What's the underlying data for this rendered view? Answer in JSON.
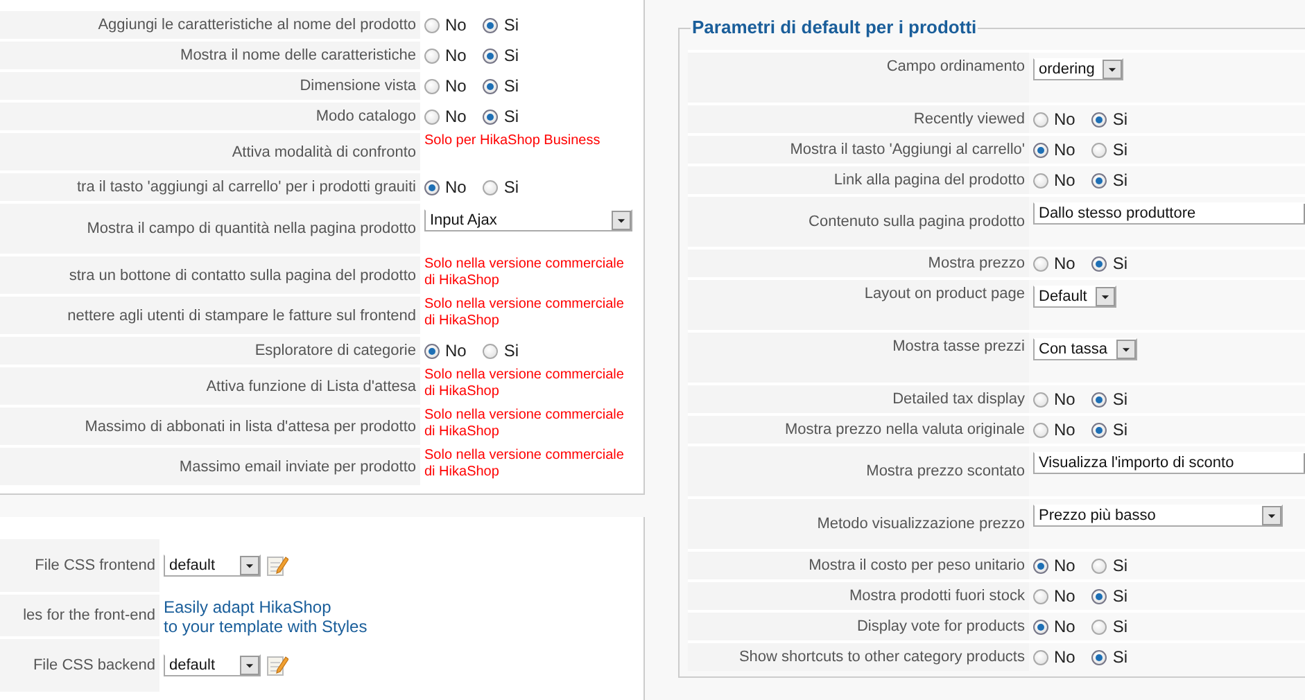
{
  "left_panel": {
    "rows": [
      {
        "label": "Aggiungi le caratteristiche al nome del prodotto",
        "kind": "radio",
        "options": [
          {
            "label": "No",
            "selected": false
          },
          {
            "label": "Si",
            "selected": true
          }
        ]
      },
      {
        "label": "Mostra il nome delle caratteristiche",
        "kind": "radio",
        "options": [
          {
            "label": "No",
            "selected": false
          },
          {
            "label": "Si",
            "selected": true
          }
        ]
      },
      {
        "label": "Dimensione vista",
        "kind": "radio",
        "options": [
          {
            "label": "No",
            "selected": false
          },
          {
            "label": "Si",
            "selected": true
          }
        ]
      },
      {
        "label": "Modo catalogo",
        "kind": "radio",
        "options": [
          {
            "label": "No",
            "selected": false
          },
          {
            "label": "Si",
            "selected": true
          }
        ]
      },
      {
        "label": "Attiva modalità di confronto",
        "kind": "note",
        "text": "Solo per HikaShop Business"
      },
      {
        "label": "tra il tasto 'aggiungi al carrello' per i prodotti grauiti",
        "kind": "radio",
        "options": [
          {
            "label": "No",
            "selected": true
          },
          {
            "label": "Si",
            "selected": false
          }
        ]
      },
      {
        "label": "Mostra il campo di quantità nella pagina prodotto",
        "kind": "select",
        "value": "Input Ajax"
      },
      {
        "label": "stra un bottone di contatto sulla pagina del prodotto",
        "kind": "note",
        "text": "Solo nella versione commerciale\ndi HikaShop"
      },
      {
        "label": "nettere agli utenti di stampare le fatture sul frontend",
        "kind": "note",
        "text": "Solo nella versione commerciale\ndi HikaShop"
      },
      {
        "label": "Esploratore di categorie",
        "kind": "radio",
        "options": [
          {
            "label": "No",
            "selected": true
          },
          {
            "label": "Si",
            "selected": false
          }
        ]
      },
      {
        "label": "Attiva funzione di Lista d'attesa",
        "kind": "note",
        "text": "Solo nella versione commerciale\ndi HikaShop"
      },
      {
        "label": "Massimo di abbonati in lista d'attesa per prodotto",
        "kind": "note",
        "text": "Solo nella versione commerciale\ndi HikaShop"
      },
      {
        "label": "Massimo email inviate per prodotto",
        "kind": "note",
        "text": "Solo nella versione commerciale\ndi HikaShop"
      }
    ]
  },
  "css_panel": {
    "rows": [
      {
        "label": "File CSS frontend",
        "kind": "css",
        "value": "default"
      },
      {
        "label": "les for the front-end",
        "kind": "link",
        "text": "Easily adapt HikaShop\nto your template with Styles"
      },
      {
        "label": "File CSS backend",
        "kind": "css",
        "value": "default"
      }
    ]
  },
  "product_defaults": {
    "title": "Parametri di default per i prodotti",
    "rows": [
      {
        "label": "Campo ordinamento",
        "kind": "select",
        "value": "ordering"
      },
      {
        "label": "Recently viewed",
        "kind": "radio",
        "options": [
          {
            "label": "No",
            "selected": false
          },
          {
            "label": "Si",
            "selected": true
          }
        ]
      },
      {
        "label": "Mostra il tasto 'Aggiungi al carrello'",
        "kind": "radio",
        "options": [
          {
            "label": "No",
            "selected": true
          },
          {
            "label": "Si",
            "selected": false
          }
        ]
      },
      {
        "label": "Link alla pagina del prodotto",
        "kind": "radio",
        "options": [
          {
            "label": "No",
            "selected": false
          },
          {
            "label": "Si",
            "selected": true
          }
        ]
      },
      {
        "label": "Contenuto sulla pagina prodotto",
        "kind": "select",
        "value": "Dallo stesso produttore"
      },
      {
        "label": "Mostra prezzo",
        "kind": "radio",
        "options": [
          {
            "label": "No",
            "selected": false
          },
          {
            "label": "Si",
            "selected": true
          }
        ]
      },
      {
        "label": "Layout on product page",
        "kind": "select",
        "value": "Default"
      },
      {
        "label": "Mostra tasse prezzi",
        "kind": "select",
        "value": "Con tassa"
      },
      {
        "label": "Detailed tax display",
        "kind": "radio",
        "options": [
          {
            "label": "No",
            "selected": false
          },
          {
            "label": "Si",
            "selected": true
          }
        ]
      },
      {
        "label": "Mostra prezzo nella valuta originale",
        "kind": "radio",
        "options": [
          {
            "label": "No",
            "selected": false
          },
          {
            "label": "Si",
            "selected": true
          }
        ]
      },
      {
        "label": "Mostra prezzo scontato",
        "kind": "select",
        "value": "Visualizza l'importo di sconto"
      },
      {
        "label": "Metodo visualizzazione prezzo",
        "kind": "select",
        "value": "Prezzo più basso"
      },
      {
        "label": "Mostra il costo per peso unitario",
        "kind": "radio",
        "options": [
          {
            "label": "No",
            "selected": true
          },
          {
            "label": "Si",
            "selected": false
          }
        ]
      },
      {
        "label": "Mostra prodotti fuori stock",
        "kind": "radio",
        "options": [
          {
            "label": "No",
            "selected": false
          },
          {
            "label": "Si",
            "selected": true
          }
        ]
      },
      {
        "label": "Display vote for products",
        "kind": "radio",
        "options": [
          {
            "label": "No",
            "selected": true
          },
          {
            "label": "Si",
            "selected": false
          }
        ]
      },
      {
        "label": "Show shortcuts to other category products",
        "kind": "radio",
        "options": [
          {
            "label": "No",
            "selected": false
          },
          {
            "label": "Si",
            "selected": true
          }
        ]
      }
    ]
  }
}
